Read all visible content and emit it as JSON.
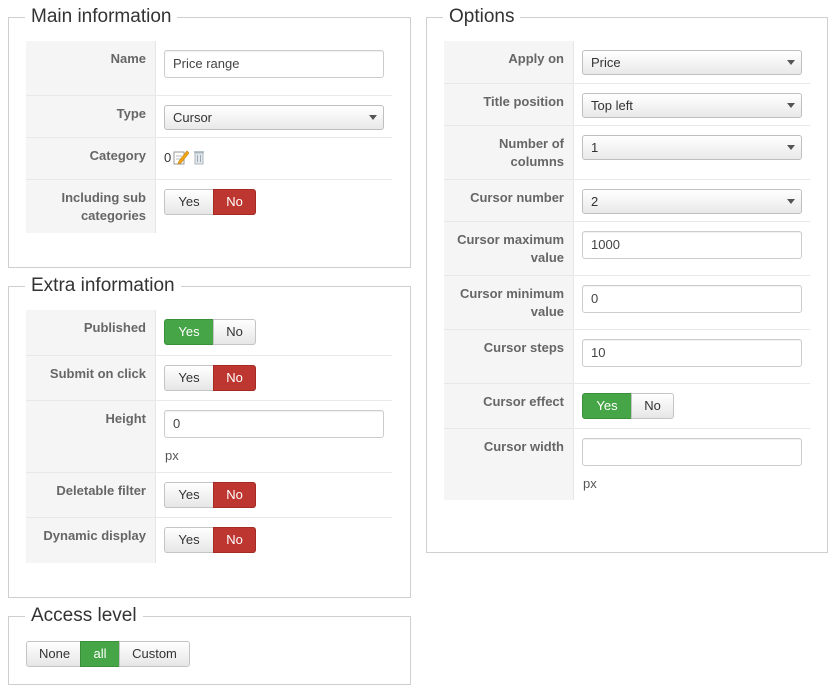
{
  "main": {
    "title": "Main information",
    "name_label": "Name",
    "name_value": "Price range",
    "type_label": "Type",
    "type_value": "Cursor",
    "category_label": "Category",
    "category_value": "0",
    "including_label": "Including sub categories",
    "including_yes": "Yes",
    "including_no": "No"
  },
  "extra": {
    "title": "Extra information",
    "published_label": "Published",
    "published_yes": "Yes",
    "published_no": "No",
    "submit_label": "Submit on click",
    "submit_yes": "Yes",
    "submit_no": "No",
    "height_label": "Height",
    "height_value": "0",
    "height_unit": "px",
    "deletable_label": "Deletable filter",
    "deletable_yes": "Yes",
    "deletable_no": "No",
    "dynamic_label": "Dynamic display",
    "dynamic_yes": "Yes",
    "dynamic_no": "No"
  },
  "access": {
    "title": "Access level",
    "none": "None",
    "all": "all",
    "custom": "Custom"
  },
  "options": {
    "title": "Options",
    "apply_label": "Apply on",
    "apply_value": "Price",
    "title_pos_label": "Title position",
    "title_pos_value": "Top left",
    "columns_label": "Number of columns",
    "columns_value": "1",
    "cursor_number_label": "Cursor number",
    "cursor_number_value": "2",
    "cursor_max_label": "Cursor maximum value",
    "cursor_max_value": "1000",
    "cursor_min_label": "Cursor minimum value",
    "cursor_min_value": "0",
    "cursor_steps_label": "Cursor steps",
    "cursor_steps_value": "10",
    "cursor_effect_label": "Cursor effect",
    "cursor_effect_yes": "Yes",
    "cursor_effect_no": "No",
    "cursor_width_label": "Cursor width",
    "cursor_width_value": "",
    "cursor_width_unit": "px"
  },
  "colors": {
    "active_no": "#bd362f",
    "active_yes": "#46a546"
  }
}
